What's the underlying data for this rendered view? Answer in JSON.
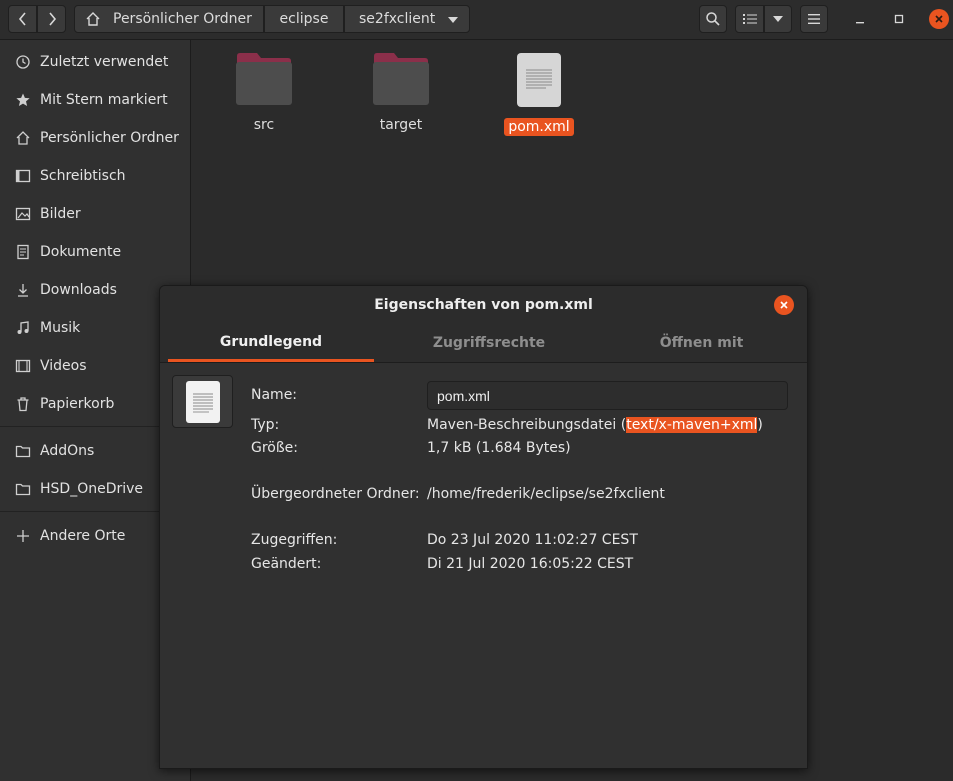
{
  "header": {
    "back_icon": "chevron-left-icon",
    "forward_icon": "chevron-right-icon",
    "breadcrumbs": [
      "Persönlicher Ordner",
      "eclipse",
      "se2fxclient"
    ]
  },
  "sidebar": {
    "items": [
      {
        "label": "Zuletzt verwendet",
        "icon": "clock-icon"
      },
      {
        "label": "Mit Stern markiert",
        "icon": "star-icon"
      },
      {
        "label": "Persönlicher Ordner",
        "icon": "home-icon"
      },
      {
        "label": "Schreibtisch",
        "icon": "desktop-icon"
      },
      {
        "label": "Bilder",
        "icon": "image-icon"
      },
      {
        "label": "Dokumente",
        "icon": "document-icon"
      },
      {
        "label": "Downloads",
        "icon": "download-icon"
      },
      {
        "label": "Musik",
        "icon": "music-icon"
      },
      {
        "label": "Videos",
        "icon": "video-icon"
      },
      {
        "label": "Papierkorb",
        "icon": "trash-icon"
      },
      {
        "label": "AddOns",
        "icon": "folder-icon"
      },
      {
        "label": "HSD_OneDrive",
        "icon": "folder-icon"
      },
      {
        "label": "Andere Orte",
        "icon": "plus-icon"
      }
    ]
  },
  "files": [
    {
      "name": "src",
      "type": "folder"
    },
    {
      "name": "target",
      "type": "folder"
    },
    {
      "name": "pom.xml",
      "type": "file",
      "selected": true
    }
  ],
  "dialog": {
    "title": "Eigenschaften von pom.xml",
    "tabs": [
      "Grundlegend",
      "Zugriffsrechte",
      "Öffnen mit"
    ],
    "active_tab": "Grundlegend",
    "labels": {
      "name": "Name:",
      "type": "Typ:",
      "size": "Größe:",
      "parent": "Übergeordneter Ordner:",
      "accessed": "Zugegriffen:",
      "modified": "Geändert:"
    },
    "values": {
      "name": "pom.xml",
      "type_prefix": "Maven-Beschreibungsdatei (",
      "type_mime": "text/x-maven+xml",
      "type_suffix": ")",
      "size": "1,7 kB (1.684 Bytes)",
      "parent": "/home/frederik/eclipse/se2fxclient",
      "accessed": "Do 23 Jul 2020 11:02:27 CEST",
      "modified": "Di 21 Jul 2020 16:05:22 CEST"
    }
  },
  "colors": {
    "accent": "#e95420",
    "folder_body": "#4d4d4d",
    "folder_tab": "#8b2f4a"
  }
}
